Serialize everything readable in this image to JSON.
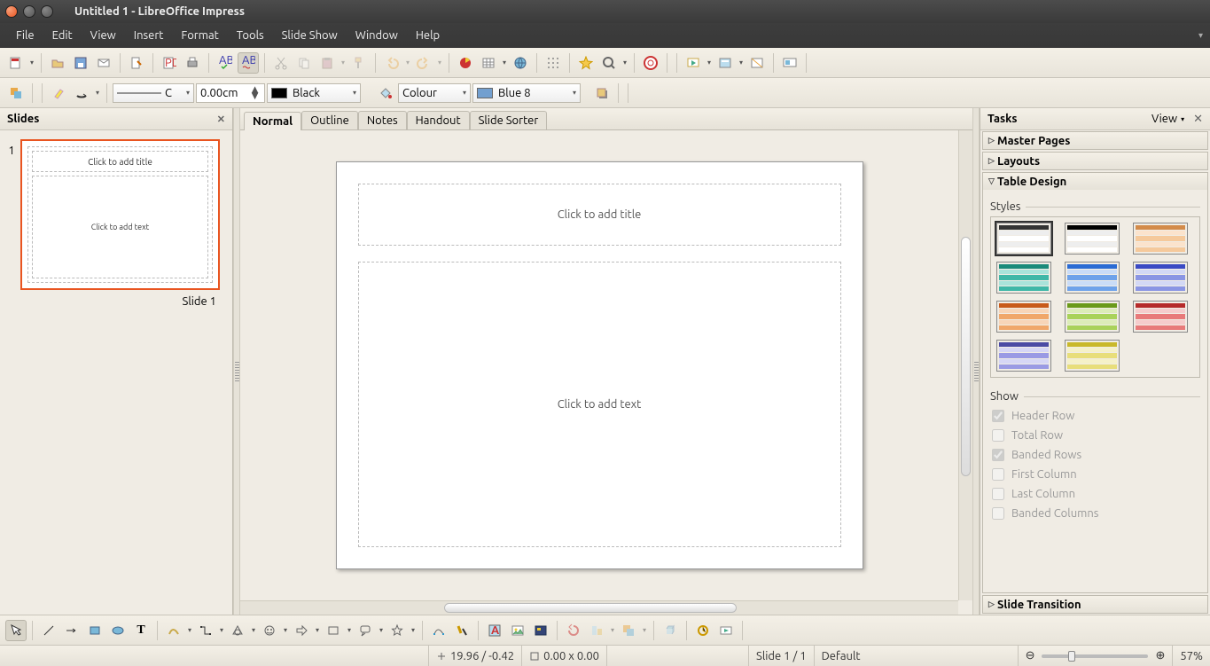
{
  "window": {
    "title": "Untitled 1 - LibreOffice Impress"
  },
  "menu": [
    "File",
    "Edit",
    "View",
    "Insert",
    "Format",
    "Tools",
    "Slide Show",
    "Window",
    "Help"
  ],
  "toolbar2": {
    "linestyle": "C",
    "linewidth": "0.00cm",
    "linecolor_label": "Black",
    "linecolor_hex": "#000000",
    "arealabel": "Colour",
    "areafill_label": "Blue 8",
    "areafill_hex": "#729fcf"
  },
  "slides_panel": {
    "title": "Slides",
    "thumb": {
      "title_ph": "Click to add title",
      "body_ph": "Click to add text"
    },
    "slide_label": "Slide 1",
    "slide_number": "1"
  },
  "tabs": [
    "Normal",
    "Outline",
    "Notes",
    "Handout",
    "Slide Sorter"
  ],
  "active_tab": 0,
  "canvas": {
    "title_ph": "Click to add title",
    "body_ph": "Click to add text"
  },
  "tasks": {
    "title": "Tasks",
    "view_label": "View",
    "sections": {
      "master": "Master Pages",
      "layouts": "Layouts",
      "table": "Table Design",
      "transition": "Slide Transition"
    },
    "styles_label": "Styles",
    "show_label": "Show",
    "checks": [
      {
        "label": "Header Row",
        "checked": true,
        "enabled": false
      },
      {
        "label": "Total Row",
        "checked": false,
        "enabled": false
      },
      {
        "label": "Banded Rows",
        "checked": true,
        "enabled": false
      },
      {
        "label": "First Column",
        "checked": false,
        "enabled": false
      },
      {
        "label": "Last Column",
        "checked": false,
        "enabled": false
      },
      {
        "label": "Banded Columns",
        "checked": false,
        "enabled": false
      }
    ],
    "style_colors": [
      [
        "#333",
        "#fff",
        "#eee"
      ],
      [
        "#000",
        "#fff",
        "#eee"
      ],
      [
        "#d38b4a",
        "#f5c99b",
        "#fbe3cc"
      ],
      [
        "#1a8a7a",
        "#3fb7a7",
        "#a9e3da"
      ],
      [
        "#2a6bd4",
        "#6ea2ea",
        "#c9dcf7"
      ],
      [
        "#3a4ac4",
        "#8a95e4",
        "#d3d8f5"
      ],
      [
        "#c85a1a",
        "#f0a76a",
        "#f7d5b8"
      ],
      [
        "#6a9a1a",
        "#a9d25a",
        "#dcecb8"
      ],
      [
        "#b52a2a",
        "#e87a7a",
        "#f5cccc"
      ],
      [
        "#4a4aa4",
        "#9a9ae4",
        "#d6d6f5"
      ],
      [
        "#c9b82a",
        "#e8de7a",
        "#f5f1c8"
      ]
    ]
  },
  "status": {
    "coords": "19.96 / -0.42",
    "size": "0.00 x 0.00",
    "slide": "Slide 1 / 1",
    "master": "Default",
    "zoom": "57%"
  }
}
